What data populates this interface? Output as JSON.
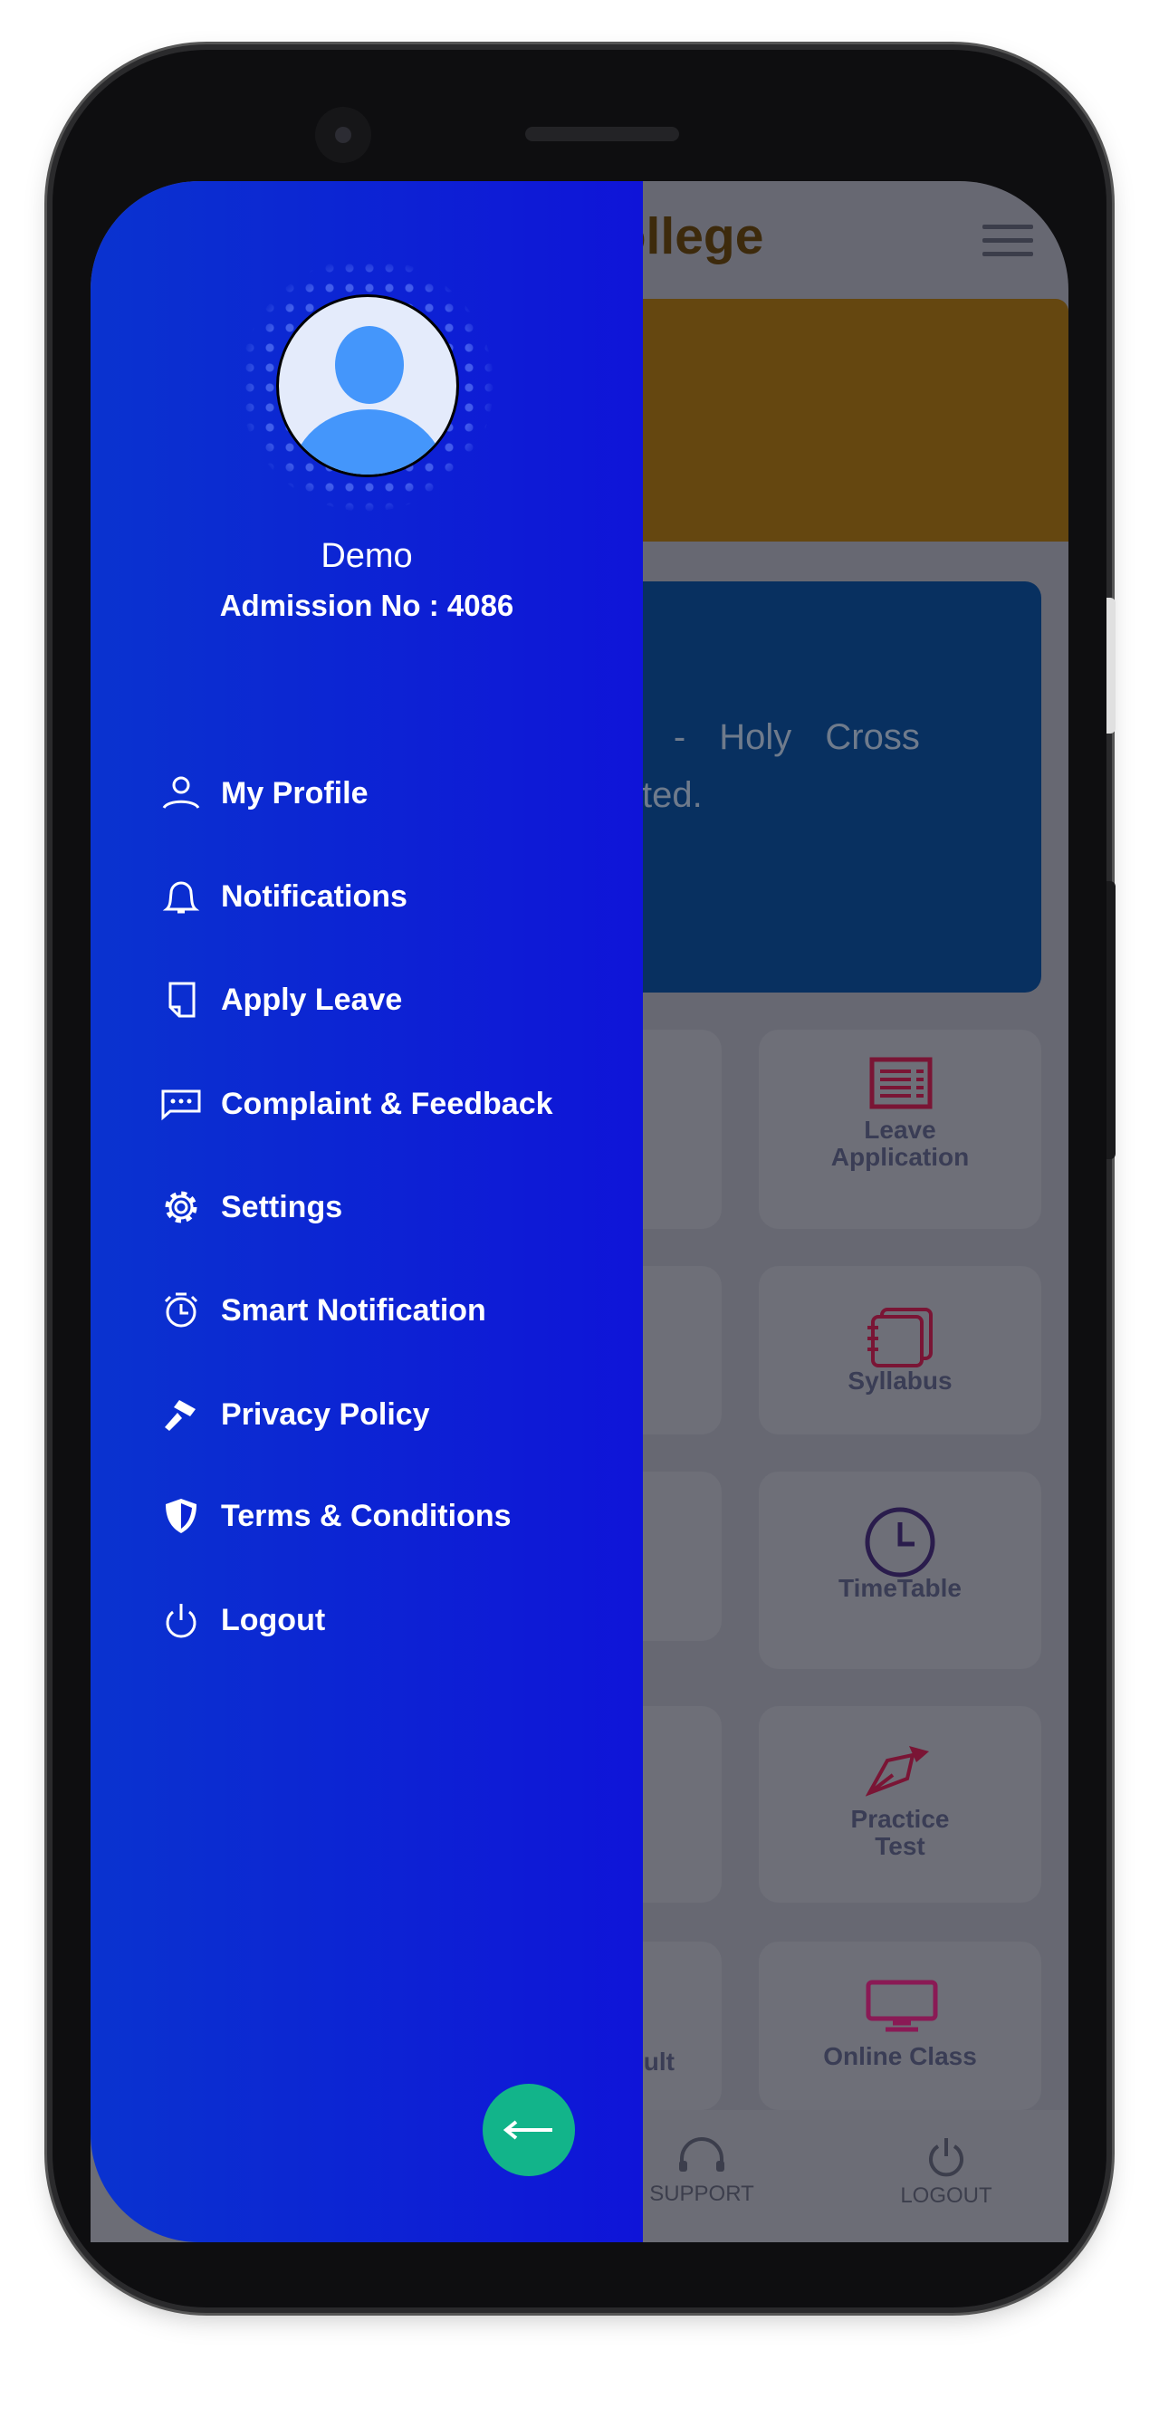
{
  "background_app": {
    "title_visible": "s College",
    "notice_line1": "Camp - Holy Cross",
    "notice_line2": "onnected.",
    "tiles": [
      {
        "label": "Leave Application",
        "icon": "receipt-icon"
      },
      {
        "label": "Syllabus",
        "icon": "notebook-icon"
      },
      {
        "label": "TimeTable",
        "icon": "clock-icon"
      },
      {
        "label": "Practice Test",
        "icon": "pen-nib-icon"
      },
      {
        "label": "Online Class",
        "icon": "monitor-icon"
      }
    ],
    "left_tile_partial_label": "ult",
    "bottom_nav": [
      {
        "label": "SUPPORT",
        "icon": "headset-icon"
      },
      {
        "label": "LOGOUT",
        "icon": "power-icon"
      }
    ],
    "colors": {
      "banner": "#654710",
      "notice_card": "#083060",
      "icon_accent": "#8a1a3a"
    }
  },
  "drawer": {
    "user": {
      "name": "Demo",
      "admission": "Admission No : 4086"
    },
    "menu": [
      {
        "label": "My Profile",
        "icon": "user-icon"
      },
      {
        "label": "Notifications",
        "icon": "bell-icon"
      },
      {
        "label": "Apply Leave",
        "icon": "note-icon"
      },
      {
        "label": "Complaint & Feedback",
        "icon": "chat-icon"
      },
      {
        "label": "Settings",
        "icon": "gear-icon"
      },
      {
        "label": "Smart Notification",
        "icon": "alarm-clock-icon"
      },
      {
        "label": "Privacy Policy",
        "icon": "gavel-icon"
      },
      {
        "label": "Terms & Conditions",
        "icon": "shield-icon"
      },
      {
        "label": "Logout",
        "icon": "power-icon"
      }
    ],
    "close_button_icon": "arrow-left-icon",
    "colors": {
      "gradient_start": "#0a33cf",
      "gradient_end": "#0f14d8",
      "fab": "#12b48a"
    }
  }
}
